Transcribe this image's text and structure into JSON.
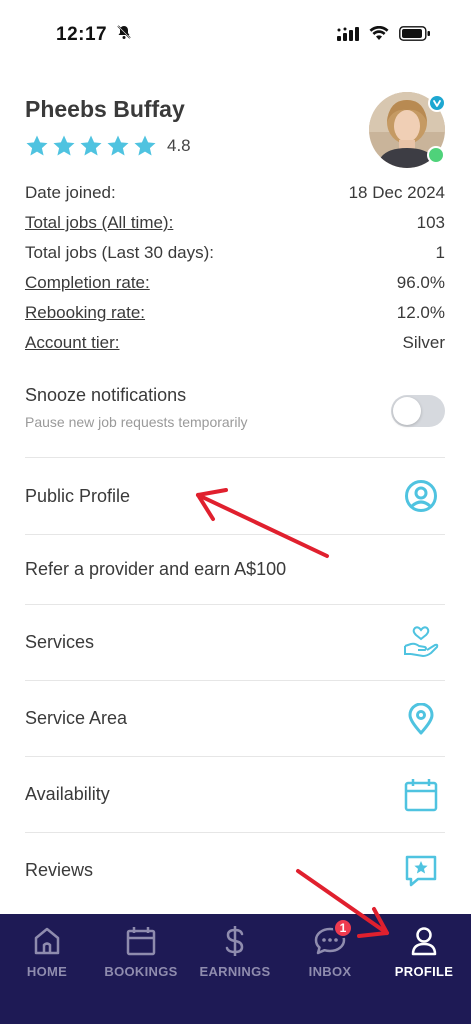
{
  "status_bar": {
    "time": "12:17"
  },
  "profile": {
    "name": "Pheebs Buffay",
    "rating": "4.8",
    "stars": 5,
    "verified": true,
    "online": true
  },
  "stats": [
    {
      "label": "Date joined:",
      "value": "18 Dec 2024",
      "link": false
    },
    {
      "label": "Total jobs (All time):",
      "value": "103",
      "link": true
    },
    {
      "label": "Total jobs (Last 30 days):",
      "value": "1",
      "link": false
    },
    {
      "label": "Completion rate:",
      "value": "96.0%",
      "link": true
    },
    {
      "label": "Rebooking rate:",
      "value": "12.0%",
      "link": true
    },
    {
      "label": "Account tier:",
      "value": "Silver",
      "link": true
    }
  ],
  "snooze": {
    "title": "Snooze notifications",
    "subtitle": "Pause new job requests temporarily",
    "enabled": false
  },
  "menu": [
    {
      "label": "Public Profile",
      "icon": "user-circle-icon"
    },
    {
      "label": "Refer a provider and earn A$100",
      "icon": ""
    },
    {
      "label": "Services",
      "icon": "hand-heart-icon"
    },
    {
      "label": "Service Area",
      "icon": "map-pin-icon"
    },
    {
      "label": "Availability",
      "icon": "calendar-icon"
    },
    {
      "label": "Reviews",
      "icon": "star-message-icon"
    }
  ],
  "nav": {
    "items": [
      {
        "label": "HOME",
        "icon": "home-icon"
      },
      {
        "label": "BOOKINGS",
        "icon": "calendar-icon"
      },
      {
        "label": "EARNINGS",
        "icon": "dollar-icon"
      },
      {
        "label": "INBOX",
        "icon": "chat-icon",
        "badge": "1"
      },
      {
        "label": "PROFILE",
        "icon": "person-icon",
        "active": true
      }
    ]
  },
  "colors": {
    "accent": "#4fc3e0",
    "nav_bg": "#1e1a55",
    "annotation_arrow": "#e0202e",
    "badge": "#ef3b4f"
  }
}
